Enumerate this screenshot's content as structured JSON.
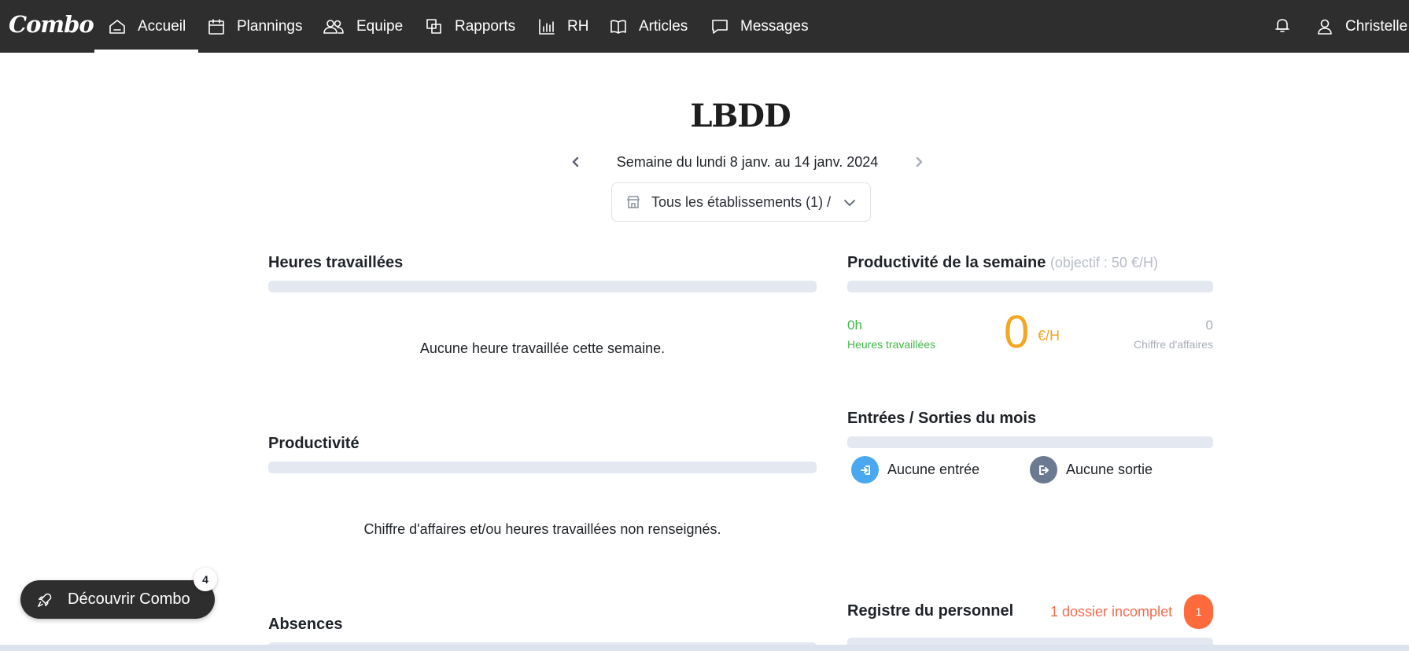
{
  "app": {
    "logo_text": "Combo"
  },
  "nav": {
    "items": [
      {
        "label": "Accueil",
        "icon": "home-icon",
        "active": true
      },
      {
        "label": "Plannings",
        "icon": "calendar-icon"
      },
      {
        "label": "Equipe",
        "icon": "team-icon"
      },
      {
        "label": "Rapports",
        "icon": "reports-icon"
      },
      {
        "label": "RH",
        "icon": "bar-chart-icon"
      },
      {
        "label": "Articles",
        "icon": "book-icon"
      },
      {
        "label": "Messages",
        "icon": "message-icon"
      }
    ],
    "user_name": "Christelle"
  },
  "header": {
    "company": "LBDD",
    "week_label": "Semaine du lundi 8 janv. au 14 janv. 2024",
    "establishments_label": "Tous les établissements (1) /"
  },
  "hours": {
    "title": "Heures travaillées",
    "empty_text": "Aucune heure travaillée cette semaine."
  },
  "productivity": {
    "title": "Productivité",
    "empty_text": "Chiffre d'affaires et/ou heures travaillées non renseignés."
  },
  "absences": {
    "title": "Absences"
  },
  "week_productivity": {
    "title": "Productivité de la semaine",
    "subtitle": "(objectif : 50 €/H)",
    "hours_value": "0h",
    "hours_label": "Heures travaillées",
    "productivity_value": "0",
    "productivity_unit": "€/H",
    "revenue_value": "0",
    "revenue_label": "Chiffre d'affaires"
  },
  "entries_exits": {
    "title": "Entrées / Sorties du mois",
    "entries_label": "Aucune entrée",
    "exits_label": "Aucune sortie"
  },
  "registry": {
    "title": "Registre du personnel",
    "alert_text": "1 dossier incomplet",
    "badge_count": "1"
  },
  "discover": {
    "label": "Découvrir Combo",
    "badge": "4"
  },
  "colors": {
    "topbar": "#2e2e2e",
    "hours_green": "#43b649",
    "productivity_orange": "#f5a623",
    "alert_red": "#f26c4f",
    "entry_blue": "#4aa8f0",
    "exit_gray": "#6b7a90"
  }
}
